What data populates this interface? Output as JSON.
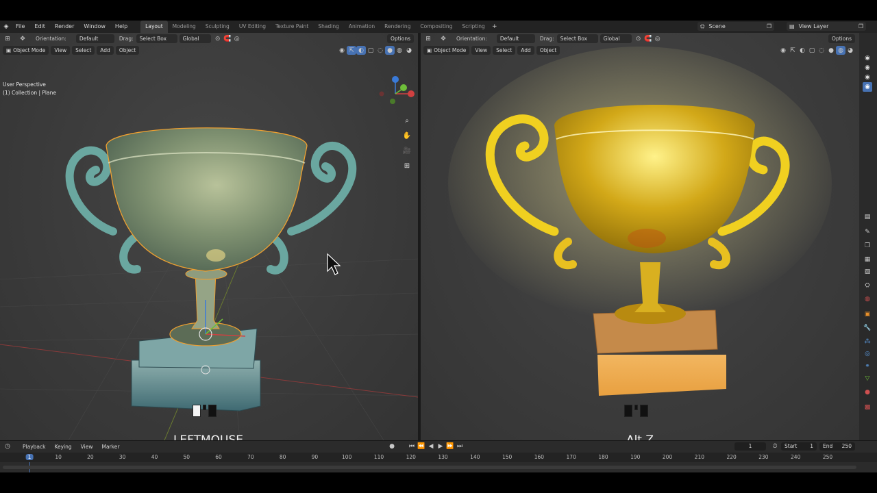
{
  "topbar": {
    "menus": [
      "File",
      "Edit",
      "Render",
      "Window",
      "Help"
    ],
    "workspaces": [
      "Layout",
      "Modeling",
      "Sculpting",
      "UV Editing",
      "Texture Paint",
      "Shading",
      "Animation",
      "Rendering",
      "Compositing",
      "Scripting"
    ],
    "active_workspace": "Layout",
    "scene": "Scene",
    "view_layer": "View Layer"
  },
  "left_viewport": {
    "orientation_label": "Orientation:",
    "orientation_value": "Default",
    "drag_label": "Drag:",
    "drag_value": "Select Box",
    "transform_value": "Global",
    "options_label": "Options",
    "mode": "Object Mode",
    "menus": [
      "View",
      "Select",
      "Add",
      "Object"
    ],
    "perspective": "User Perspective",
    "collection": "(1) Collection | Plane",
    "key_display": "LEFTMOUSE"
  },
  "right_viewport": {
    "orientation_label": "Orientation:",
    "orientation_value": "Default",
    "drag_label": "Drag:",
    "drag_value": "Select Box",
    "transform_value": "Global",
    "options_label": "Options",
    "mode": "Object Mode",
    "menus": [
      "View",
      "Select",
      "Add",
      "Object"
    ],
    "key_display": "Alt Z"
  },
  "timeline": {
    "menus": [
      "Playback",
      "Keying",
      "View",
      "Marker"
    ],
    "current_frame": "1",
    "start_label": "Start",
    "start_value": "1",
    "end_label": "End",
    "end_value": "250",
    "ruler": [
      "1",
      "10",
      "20",
      "30",
      "40",
      "50",
      "60",
      "70",
      "80",
      "90",
      "100",
      "110",
      "120",
      "130",
      "140",
      "150",
      "160",
      "170",
      "180",
      "190",
      "200",
      "210",
      "220",
      "230",
      "240",
      "250"
    ]
  },
  "colors": {
    "accent": "#4772b3",
    "selection_outline": "#f0a030",
    "trophy_left": "#6a9a90",
    "trophy_right": "#e8c020",
    "base_right": "#e0a050"
  }
}
